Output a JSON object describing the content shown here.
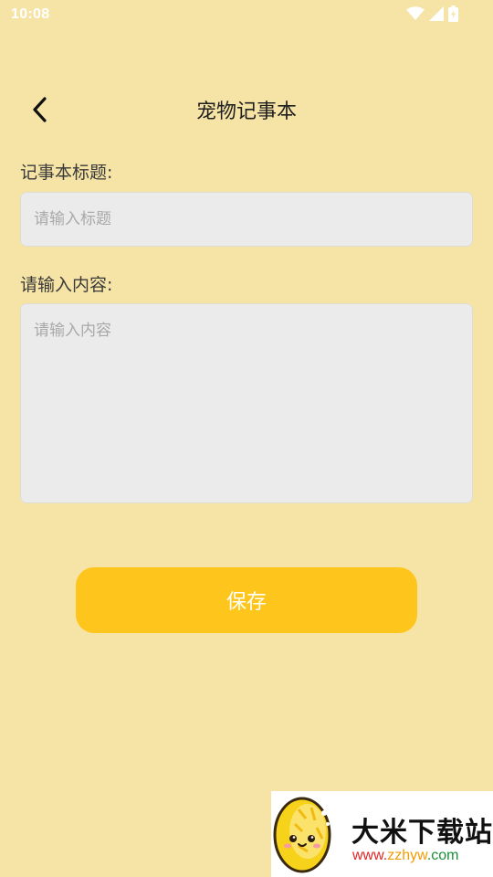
{
  "status_bar": {
    "time": "10:08",
    "icons": [
      "wifi-icon",
      "signal-icon",
      "battery-charging-icon"
    ]
  },
  "header": {
    "back_icon": "chevron-left-icon",
    "title": "宠物记事本"
  },
  "form": {
    "title_label": "记事本标题:",
    "title_value": "",
    "title_placeholder": "请输入标题",
    "content_label": "请输入内容:",
    "content_value": "",
    "content_placeholder": "请输入内容"
  },
  "actions": {
    "save_label": "保存"
  },
  "watermark": {
    "name": "大米下载站",
    "url_part_1": "www.",
    "url_part_2": "zzhyw",
    "url_part_3": ".com"
  },
  "colors": {
    "background": "#f6e4a7",
    "input_background": "#ebebeb",
    "save_button": "#fec61d",
    "save_text": "#ffffff"
  }
}
